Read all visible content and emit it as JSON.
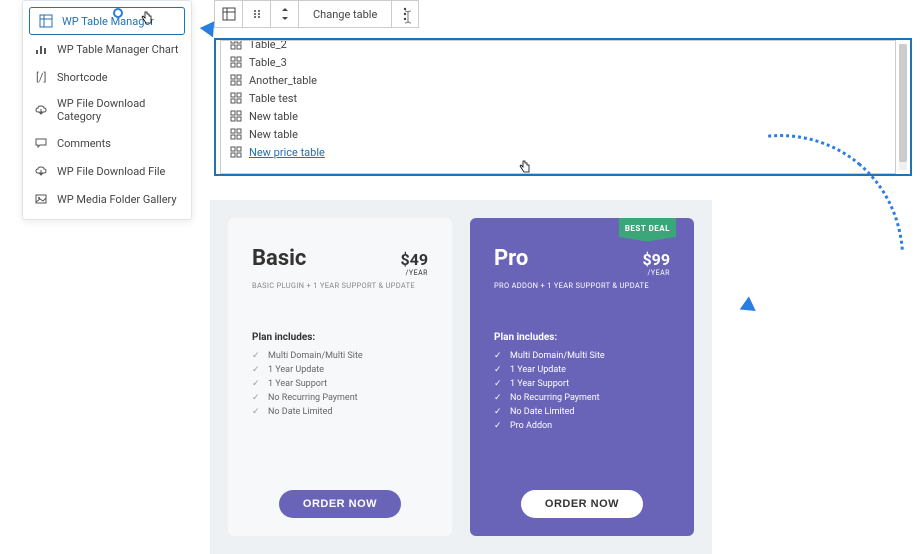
{
  "block_menu": {
    "items": [
      {
        "label": "WP Table Manager",
        "name": "block-wp-table-manager",
        "icon": "table-icon"
      },
      {
        "label": "WP Table Manager Chart",
        "name": "block-wp-table-manager-chart",
        "icon": "chart-icon"
      },
      {
        "label": "Shortcode",
        "name": "block-shortcode",
        "icon": "shortcode-icon"
      },
      {
        "label": "WP File Download Category",
        "name": "block-wp-file-download-category",
        "icon": "cloud-icon"
      },
      {
        "label": "Comments",
        "name": "block-comments",
        "icon": "comments-icon"
      },
      {
        "label": "WP File Download File",
        "name": "block-wp-file-download-file",
        "icon": "cloud-icon"
      },
      {
        "label": "WP Media Folder Gallery",
        "name": "block-wp-media-folder-gallery",
        "icon": "gallery-icon"
      }
    ]
  },
  "toolbar": {
    "change_label": "Change table"
  },
  "dropdown": {
    "items": [
      {
        "label": "Table_2",
        "name": "table-option-table2",
        "truncated": true
      },
      {
        "label": "Table_3",
        "name": "table-option-table3"
      },
      {
        "label": "Another_table",
        "name": "table-option-another"
      },
      {
        "label": "Table test",
        "name": "table-option-tabletest"
      },
      {
        "label": "New table",
        "name": "table-option-newtable1"
      },
      {
        "label": "New table",
        "name": "table-option-newtable2"
      },
      {
        "label": "New price table",
        "name": "table-option-newpricetable",
        "hovered": true
      }
    ]
  },
  "pricing": {
    "basic": {
      "title": "Basic",
      "price": "$49",
      "per": "/YEAR",
      "sub": "BASIC PLUGIN + 1 YEAR SUPPORT & UPDATE",
      "includes_label": "Plan includes:",
      "features": [
        "Multi Domain/Multi Site",
        "1 Year Update",
        "1 Year Support",
        "No Recurring Payment",
        "No Date Limited"
      ],
      "order": "ORDER NOW"
    },
    "pro": {
      "badge": "BEST\nDEAL",
      "title": "Pro",
      "price": "$99",
      "per": "/YEAR",
      "sub": "PRO ADDON + 1 YEAR SUPPORT & UPDATE",
      "includes_label": "Plan includes:",
      "features": [
        "Multi Domain/Multi Site",
        "1 Year Update",
        "1 Year Support",
        "No Recurring Payment",
        "No Date Limited",
        "Pro Addon"
      ],
      "order": "ORDER NOW"
    }
  }
}
